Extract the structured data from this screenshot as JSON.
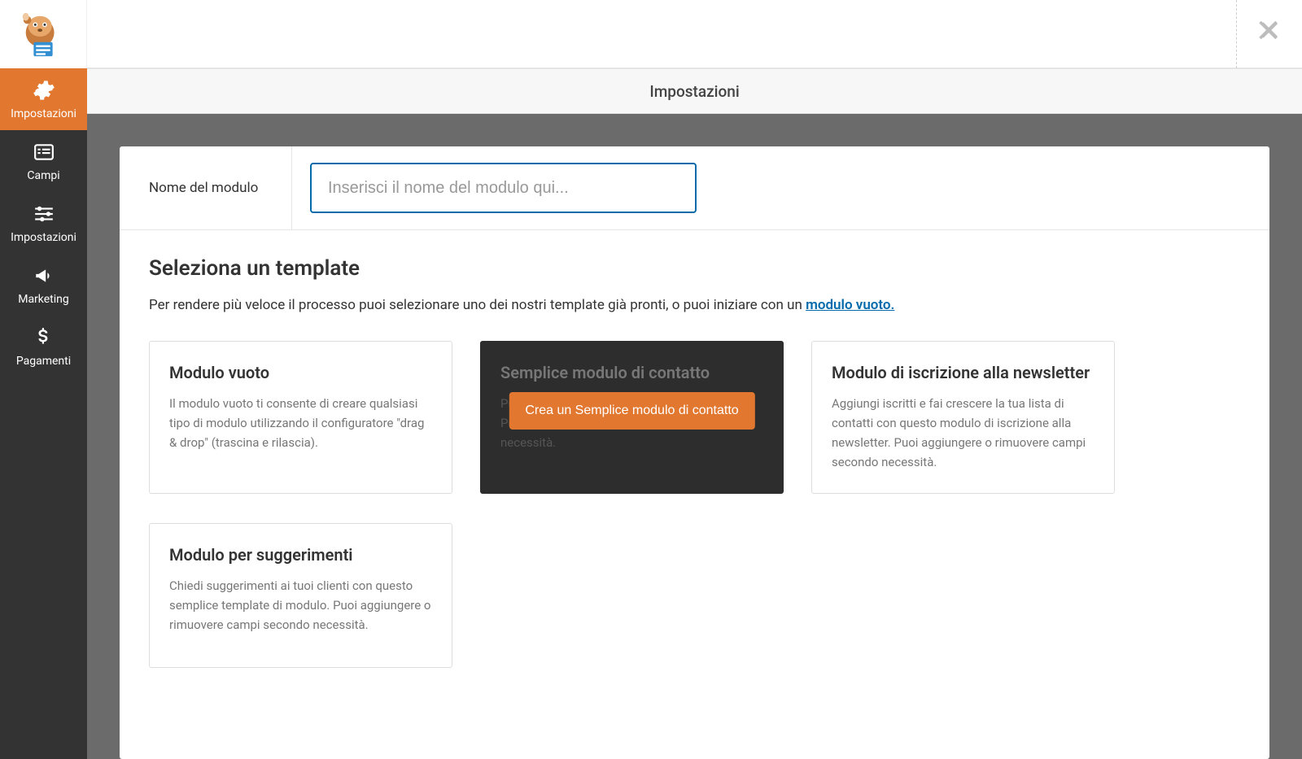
{
  "header": {
    "title": "Impostazioni"
  },
  "sidebar": {
    "items": [
      {
        "label": "Impostazioni"
      },
      {
        "label": "Campi"
      },
      {
        "label": "Impostazioni"
      },
      {
        "label": "Marketing"
      },
      {
        "label": "Pagamenti"
      }
    ]
  },
  "form_name": {
    "label": "Nome del modulo",
    "placeholder": "Inserisci il nome del modulo qui...",
    "value": ""
  },
  "templates": {
    "title": "Seleziona un template",
    "subtitle_prefix": "Per rendere più veloce il processo puoi selezionare uno dei nostri template già pronti, o puoi iniziare con un ",
    "subtitle_link": "modulo vuoto.",
    "cards": [
      {
        "title": "Modulo vuoto",
        "desc": "Il modulo vuoto ti consente di creare qualsiasi tipo di modulo utilizzando il configuratore \"drag & drop\" (trascina e rilascia)."
      },
      {
        "title": "Semplice modulo di contatto",
        "desc": "Puoi creare un semplice modulo di contatto. Puoi aggiungere o rimuovere campi secondo necessità.",
        "button": "Crea un Semplice modulo di contatto"
      },
      {
        "title": "Modulo di iscrizione alla newsletter",
        "desc": "Aggiungi iscritti e fai crescere la tua lista di contatti con questo modulo di iscrizione alla newsletter. Puoi aggiungere o rimuovere campi secondo necessità."
      },
      {
        "title": "Modulo per suggerimenti",
        "desc": "Chiedi suggerimenti ai tuoi clienti con questo semplice template di modulo. Puoi aggiungere o rimuovere campi secondo necessità."
      }
    ]
  }
}
